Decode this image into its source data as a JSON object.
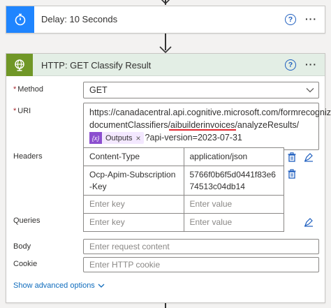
{
  "delay_card": {
    "title": "Delay: 10 Seconds",
    "help_glyph": "?",
    "more_glyph": "···",
    "accent": "#1f85ff"
  },
  "http_card": {
    "title": "HTTP: GET Classify Result",
    "help_glyph": "?",
    "more_glyph": "···",
    "accent": "#709727",
    "header_bg": "#e3eee5",
    "method": {
      "label": "Method",
      "required_mark": "*",
      "value": "GET"
    },
    "uri": {
      "label": "URI",
      "required_mark": "*",
      "line1": "https://canadacentral.api.cognitive.microsoft.com/formrecognizer/",
      "line2_prefix": "documentClassifiers/",
      "line2_highlight": "aibuilderinvoices",
      "line2_suffix": "/analyzeResults/",
      "token_label": "Outputs",
      "token_close": "×",
      "line3_suffix": "?api-version=2023-07-31",
      "highlight_color": "#e3252d"
    },
    "headers": {
      "label": "Headers",
      "rows": [
        {
          "key": "Content-Type",
          "value": "application/json"
        },
        {
          "key": "Ocp-Apim-Subscription-Key",
          "value": "5766f0b6f5d0441f83e674513c04db14"
        }
      ],
      "key_placeholder": "Enter key",
      "value_placeholder": "Enter value"
    },
    "queries": {
      "label": "Queries",
      "key_placeholder": "Enter key",
      "value_placeholder": "Enter value"
    },
    "body": {
      "label": "Body",
      "placeholder": "Enter request content"
    },
    "cookie": {
      "label": "Cookie",
      "placeholder": "Enter HTTP cookie"
    },
    "show_advanced": "Show advanced options",
    "link_color": "#0f6cbd"
  },
  "icons": {
    "delay": "stopwatch-icon",
    "http": "globe-icon",
    "help": "help-icon",
    "more": "more-options-icon",
    "chevron": "chevron-down-icon",
    "trash": "trash-icon",
    "switch_mode": "switch-text-mode-icon",
    "token": "expression-icon"
  }
}
